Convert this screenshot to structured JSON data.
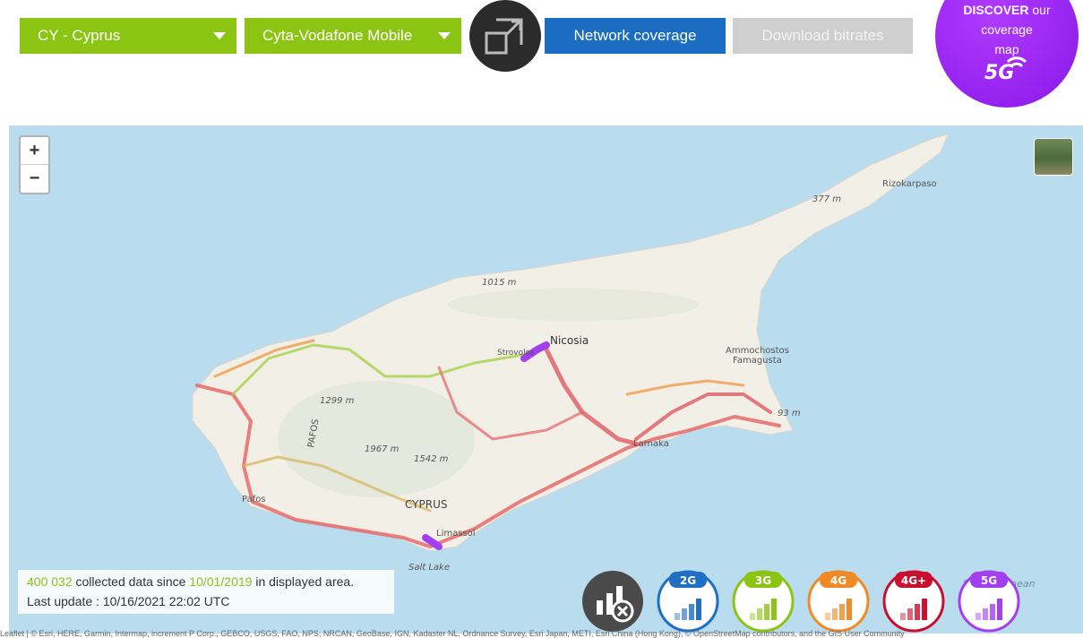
{
  "controls": {
    "country": "CY - Cyprus",
    "operator": "Cyta-Vodafone Mobile",
    "network_coverage": "Network coverage",
    "download_bitrates": "Download bitrates"
  },
  "discover": {
    "word1": "DISCOVER",
    "word2": "our",
    "line2": "coverage",
    "line3": "map",
    "badge": "5G"
  },
  "map": {
    "zoom_in": "+",
    "zoom_out": "−",
    "labels": {
      "rizokarpaso": "Rizokarpaso",
      "elev377": "377 m",
      "elev1015": "1015 m",
      "nicosia": "Nicosia",
      "strovolos": "Strovolos",
      "ammochostos": "Ammochostos",
      "famagusta": "Famagusta",
      "elev1299": "1299 m",
      "pafos_region": "PAFOS",
      "elev1967": "1967 m",
      "elev1542": "1542 m",
      "larnaka": "Larnaka",
      "elev93": "93 m",
      "pafos": "Pafos",
      "cyprus": "CYPRUS",
      "limassol": "Limassol",
      "salt_lake": "Salt Lake",
      "mediterranean": "Mediterranean"
    }
  },
  "stats": {
    "count": "400 032",
    "collected_text": "collected data since",
    "since_date": "10/01/2019",
    "area_text": "in displayed area.",
    "last_update": "Last update : 10/16/2021 22:02 UTC"
  },
  "tech": [
    "2G",
    "3G",
    "4G",
    "4G+",
    "5G"
  ],
  "colors": {
    "green": "#8cc413",
    "blue": "#1a6dc3",
    "purple": "#9b2cf5",
    "tech_2g": "#1f6fc5",
    "tech_3g": "#8cc413",
    "tech_4g": "#f08a24",
    "tech_4gplus": "#c8102e",
    "tech_5g": "#a23ff0"
  },
  "attribution": "Leaflet | © Esri, HERE, Garmin, Intermap, increment P Corp., GEBCO, USGS, FAO, NPS, NRCAN, GeoBase, IGN, Kadaster NL, Ordnance Survey, Esri Japan, METI, Esri China (Hong Kong), © OpenStreetMap contributors, and the GIS User Community"
}
